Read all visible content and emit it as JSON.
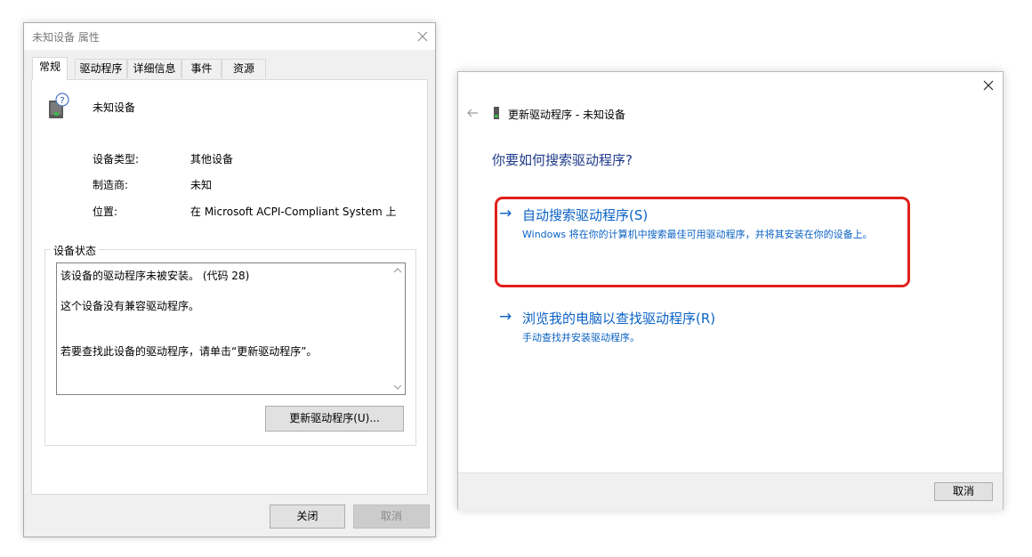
{
  "props_dialog": {
    "title": "未知设备 属性",
    "tabs": [
      "常规",
      "驱动程序",
      "详细信息",
      "事件",
      "资源"
    ],
    "device_name": "未知设备",
    "fields": [
      {
        "label": "设备类型:",
        "value": "其他设备"
      },
      {
        "label": "制造商:",
        "value": "未知"
      },
      {
        "label": "位置:",
        "value": "在 Microsoft ACPI-Compliant System 上"
      }
    ],
    "status_group_title": "设备状态",
    "status_lines": [
      "该设备的驱动程序未被安装。 (代码 28)",
      "这个设备没有兼容驱动程序。",
      "若要查找此设备的驱动程序，请单击“更新驱动程序”。"
    ],
    "update_button": "更新驱动程序(U)...",
    "close_button": "关闭",
    "cancel_button": "取消"
  },
  "update_wizard": {
    "title": "更新驱动程序 - 未知设备",
    "heading": "你要如何搜索驱动程序?",
    "options": [
      {
        "title": "自动搜索驱动程序(S)",
        "description": "Windows 将在你的计算机中搜索最佳可用驱动程序，并将其安装在你的设备上。"
      },
      {
        "title": "浏览我的电脑以查找驱动程序(R)",
        "description": "手动查找并安装驱动程序。"
      }
    ],
    "cancel_button": "取消"
  },
  "colors": {
    "link": "#0b62c4",
    "heading": "#1f3a8a",
    "highlight": "#e0201b"
  }
}
